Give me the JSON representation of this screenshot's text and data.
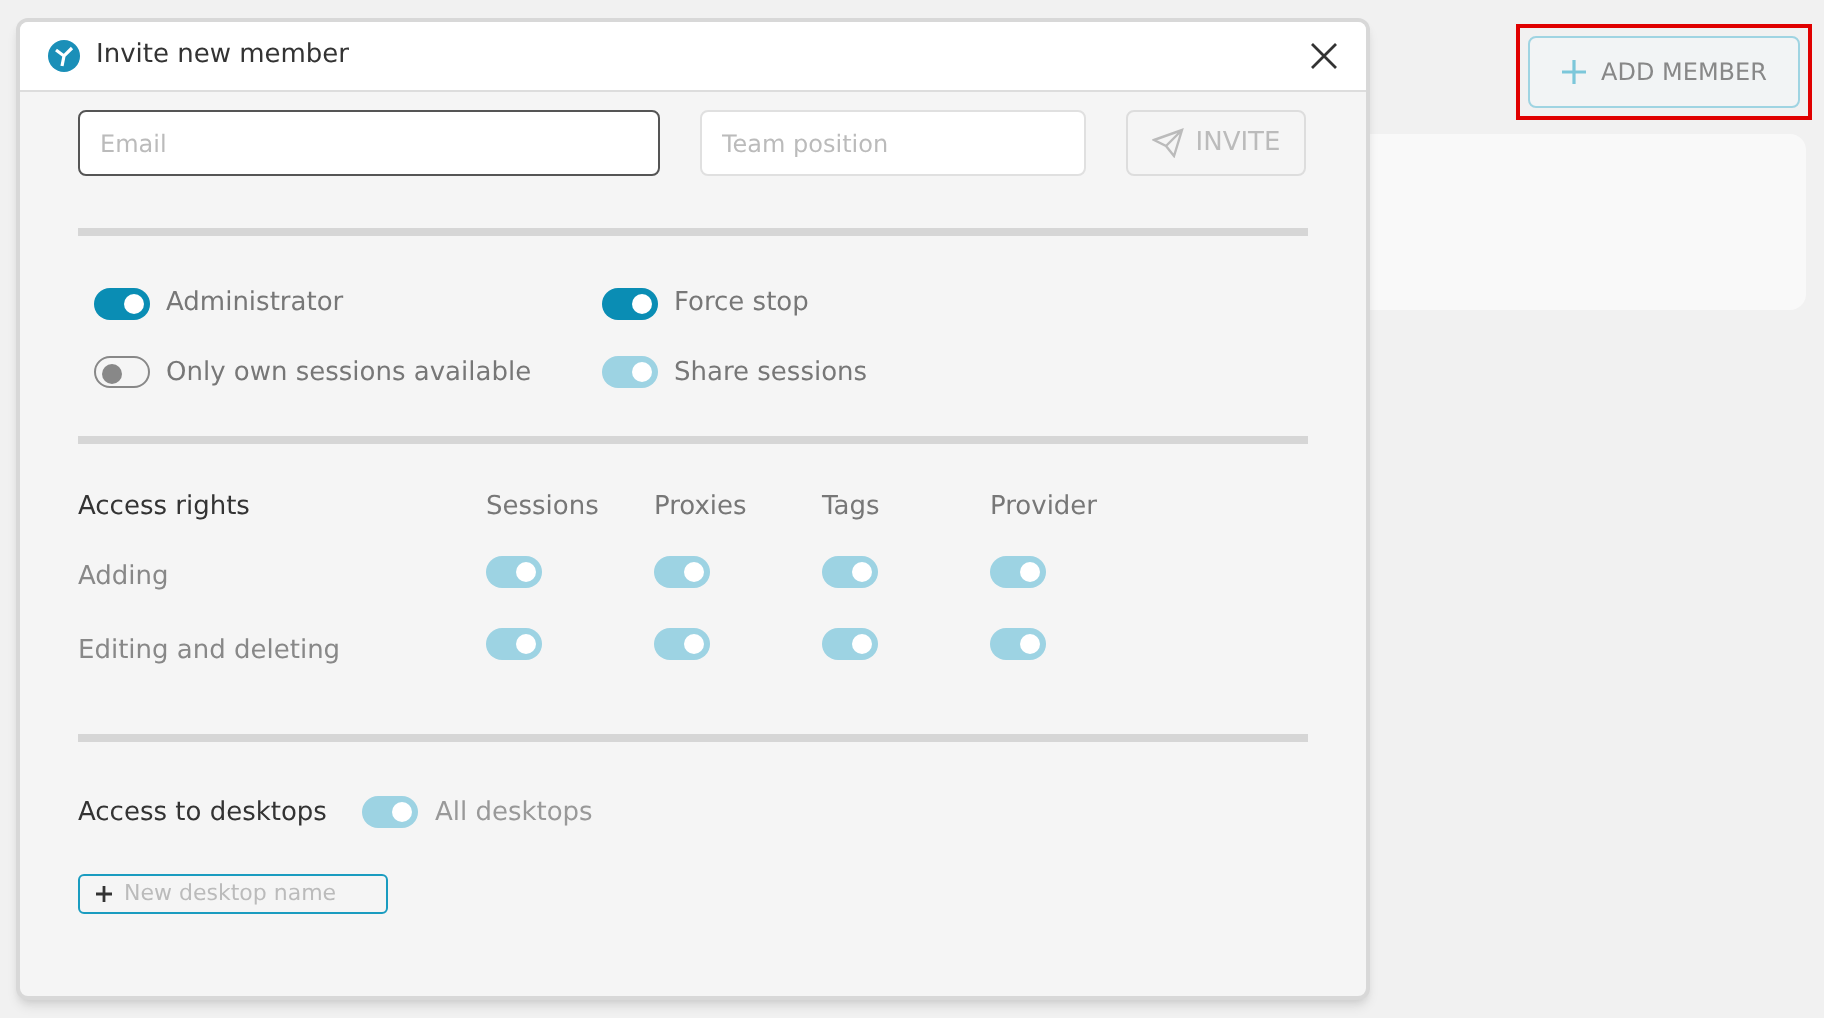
{
  "add_member_button": {
    "label": "ADD MEMBER",
    "highlighted": true
  },
  "dialog": {
    "title": "Invite new member",
    "email_field": {
      "placeholder": "Email",
      "focused": true
    },
    "position_field": {
      "placeholder": "Team position"
    },
    "invite_button": {
      "label": "INVITE",
      "disabled": true
    },
    "options": [
      {
        "label": "Administrator",
        "on": true,
        "disabled": false
      },
      {
        "label": "Force stop",
        "on": true,
        "disabled": false
      },
      {
        "label": "Only own sessions available",
        "on": false,
        "disabled": false
      },
      {
        "label": "Share sessions",
        "on": true,
        "disabled": true
      }
    ],
    "access_rights": {
      "title": "Access rights",
      "columns": [
        "Sessions",
        "Proxies",
        "Tags",
        "Provider"
      ],
      "rows": [
        {
          "label": "Adding",
          "toggles": [
            {
              "on": true,
              "disabled": true
            },
            {
              "on": true,
              "disabled": true
            },
            {
              "on": true,
              "disabled": true
            },
            {
              "on": true,
              "disabled": true
            }
          ]
        },
        {
          "label": "Editing and deleting",
          "toggles": [
            {
              "on": true,
              "disabled": true
            },
            {
              "on": true,
              "disabled": true
            },
            {
              "on": true,
              "disabled": true
            },
            {
              "on": true,
              "disabled": true
            }
          ]
        }
      ]
    },
    "desktops": {
      "label": "Access to desktops",
      "toggle": {
        "label": "All desktops",
        "on": true,
        "disabled": true
      },
      "new_desktop_field": {
        "placeholder": "New desktop name"
      }
    }
  }
}
